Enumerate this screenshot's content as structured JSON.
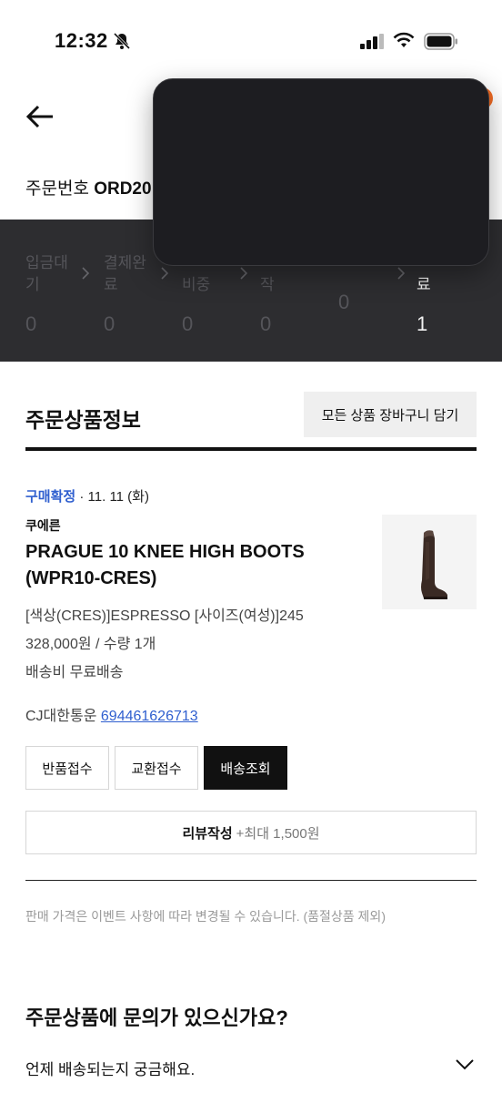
{
  "status_bar": {
    "time": "12:32"
  },
  "order": {
    "number_label": "주문번호",
    "number_value": "ORD20"
  },
  "progress": {
    "steps": [
      {
        "label": "입금대\n기",
        "count": "0",
        "active": false
      },
      {
        "label": "결제완\n료",
        "count": "0",
        "active": false
      },
      {
        "label": "\n비중",
        "count": "0",
        "active": false
      },
      {
        "label": "\n작",
        "count": "0",
        "active": false
      },
      {
        "label": "",
        "count": "0",
        "active": false
      },
      {
        "label": "\n료",
        "count": "1",
        "active": true
      }
    ]
  },
  "section": {
    "title": "주문상품정보",
    "cart_button": "모든 상품 장바구니 담기"
  },
  "item": {
    "status": "구매확정",
    "date": " · 11. 11 (화)",
    "brand": "쿠에른",
    "name": "PRAGUE 10 KNEE HIGH BOOTS (WPR10-CRES)",
    "option": "[색상(CRES)]ESPRESSO [사이즈(여성)]245",
    "price": "328,000원 / 수량 1개",
    "shipping": "배송비 무료배송",
    "courier": "CJ대한통운",
    "tracking": "694461626713"
  },
  "actions": {
    "return": "반품접수",
    "exchange": "교환접수",
    "track": "배송조회",
    "review": "리뷰작성",
    "review_sub": "+최대 1,500원"
  },
  "notice": "판매 가격은 이벤트 사항에 따라 변경될 수 있습니다. (품절상품 제외)",
  "faq": {
    "title": "주문상품에 문의가 있으신가요?",
    "q1": "언제 배송되는지 궁금해요."
  },
  "colors": {
    "accent_blue": "#2f5fcf",
    "progress_bg": "#2d2d30",
    "notif_orange": "#f06a23"
  },
  "icons": [
    "bell-slash-icon",
    "signal-icon",
    "wifi-icon",
    "battery-icon",
    "back-arrow-icon",
    "chevron-right-icon",
    "chevron-down-icon"
  ]
}
